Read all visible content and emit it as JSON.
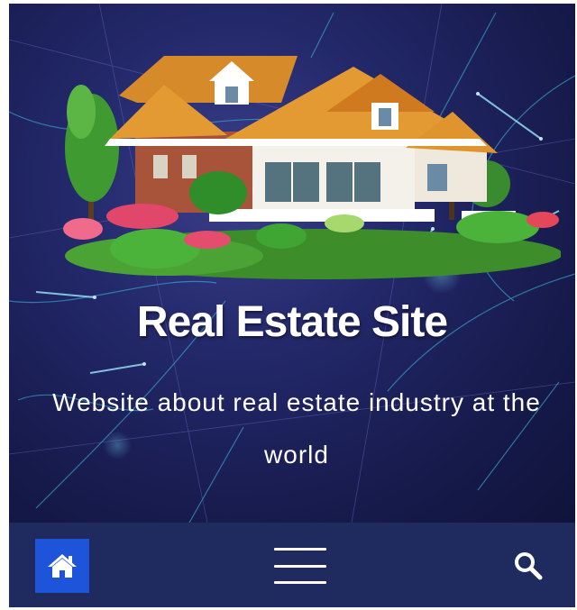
{
  "hero": {
    "title": "Real Estate Site",
    "tagline": "Website about real estate industry at the world",
    "image": "house-with-garden-illustration"
  },
  "navbar": {
    "home_icon": "home-icon",
    "menu_icon": "hamburger-menu-icon",
    "search_icon": "search-icon",
    "background_color": "#1f2b5e",
    "home_button_color": "#1e54d9"
  }
}
